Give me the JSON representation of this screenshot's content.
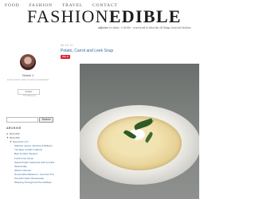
{
  "nav": {
    "items": [
      "FOOD",
      "FASHION",
      "TRAVEL",
      "CONTACT"
    ]
  },
  "logo": {
    "part1": "FASHION",
    "part2": "EDIBLE"
  },
  "tagline": {
    "bold": "adjective",
    "text": "fa·shion - e·di·ble - word used to describe all things food and fashion"
  },
  "sidebar": {
    "profile_name": "Grace J",
    "profile_sub": "Lorem ipsum dolor sit amet consectetur",
    "follow_label": "Follow",
    "follow_count": "15 followers",
    "search_button": "Search",
    "archive_title": "ARCHIVE",
    "archive": [
      {
        "text": "► 2013 (82)",
        "level": "top"
      },
      {
        "text": "▼ 2012 (89)",
        "level": "top"
      },
      {
        "text": "▼ December (17)",
        "level": "sub"
      },
      {
        "text": "Stephen Lauren Jasmine & Bellamy",
        "level": "post"
      },
      {
        "text": "The Best of 2012: Fashion",
        "level": "post"
      },
      {
        "text": "Best of 2012: Recipes",
        "level": "post"
      },
      {
        "text": "Fresh Lime Green",
        "level": "post"
      },
      {
        "text": "Sweet Potato Casserole with Crumble Pecan Topping",
        "level": "post"
      },
      {
        "text": "Wednesday",
        "level": "post"
      },
      {
        "text": "Winter Caramel",
        "level": "post"
      },
      {
        "text": "Homemade Macarons - Gourmet Treat",
        "level": "post"
      },
      {
        "text": "Pumpkin Cake Cheesecake",
        "level": "post"
      },
      {
        "text": "Weaving Through and the Holidays",
        "level": "post"
      }
    ]
  },
  "post": {
    "date": "30.10.11",
    "title": "Potato, Carrot and Leek Soup",
    "pin_label": "Pin it"
  }
}
